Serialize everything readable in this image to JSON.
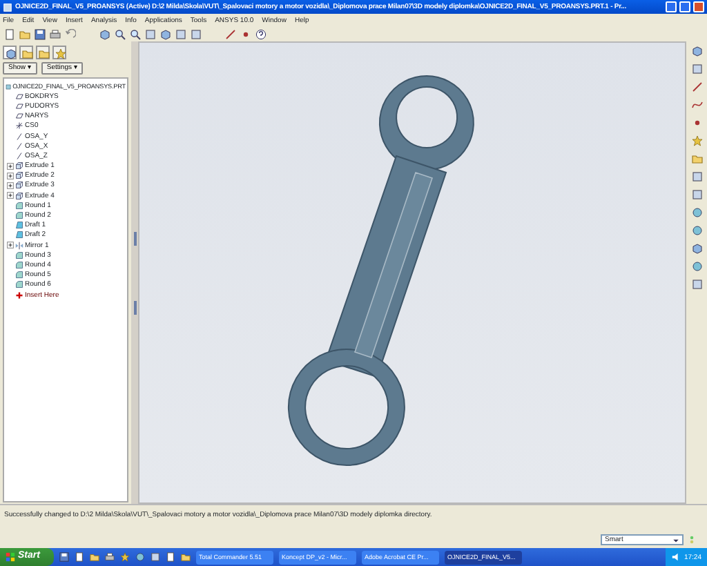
{
  "window": {
    "title": "OJNICE2D_FINAL_V5_PROANSYS (Active) D:\\2 Milda\\Skola\\VUT\\_Spalovaci motory a motor vozidla\\_Diplomova prace Milan07\\3D modely diplomka\\OJNICE2D_FINAL_V5_PROANSYS.PRT.1 - Pr..."
  },
  "menu": [
    "File",
    "Edit",
    "View",
    "Insert",
    "Analysis",
    "Info",
    "Applications",
    "Tools",
    "ANSYS 10.0",
    "Window",
    "Help"
  ],
  "panel": {
    "tabs": [
      {
        "selected": true
      },
      {
        "selected": false
      },
      {
        "selected": false
      },
      {
        "selected": false
      }
    ],
    "buttons": [
      "Show ▾",
      "Settings ▾"
    ],
    "tree": {
      "label": "OJNICE2D_FINAL_V5_PROANSYS.PRT",
      "children": [
        {
          "label": "BOKDRYS",
          "kind": "plane",
          "expander": false
        },
        {
          "label": "PUDORYS",
          "kind": "plane",
          "expander": false
        },
        {
          "label": "NARYS",
          "kind": "plane",
          "expander": false
        },
        {
          "label": "CS0",
          "kind": "csys",
          "expander": false
        },
        {
          "label": "OSA_Y",
          "kind": "axis",
          "expander": false
        },
        {
          "label": "OSA_X",
          "kind": "axis",
          "expander": false
        },
        {
          "label": "OSA_Z",
          "kind": "axis",
          "expander": false
        },
        {
          "label": "Extrude 1",
          "kind": "extrude",
          "expander": true
        },
        {
          "label": "Extrude 2",
          "kind": "extrude",
          "expander": true
        },
        {
          "label": "Extrude 3",
          "kind": "extrude",
          "expander": true
        },
        {
          "label": "Extrude 4",
          "kind": "extrude",
          "expander": true
        },
        {
          "label": "Round 1",
          "kind": "round",
          "expander": false
        },
        {
          "label": "Round 2",
          "kind": "round",
          "expander": false
        },
        {
          "label": "Draft 1",
          "kind": "draft",
          "expander": false
        },
        {
          "label": "Draft 2",
          "kind": "draft",
          "expander": false
        },
        {
          "label": "Mirror 1",
          "kind": "mirror",
          "expander": true
        },
        {
          "label": "Round 3",
          "kind": "round",
          "expander": false
        },
        {
          "label": "Round 4",
          "kind": "round",
          "expander": false
        },
        {
          "label": "Round 5",
          "kind": "round",
          "expander": false
        },
        {
          "label": "Round 6",
          "kind": "round",
          "expander": false
        },
        {
          "label": "Insert Here",
          "kind": "insert",
          "expander": false
        }
      ]
    }
  },
  "message": "Successfully changed to D:\\2 Milda\\Skola\\VUT\\_Spalovaci motory a motor vozidla\\_Diplomova prace Milan07\\3D modely diplomka directory.",
  "filter": {
    "value": "Smart"
  },
  "taskbar": {
    "start": "Start",
    "tasks": [
      {
        "label": "Total Commander 5.51",
        "selected": false
      },
      {
        "label": "Koncept DP_v2 - Micr...",
        "selected": false
      },
      {
        "label": "Adobe Acrobat CE Pr...",
        "selected": false
      },
      {
        "label": "OJNICE2D_FINAL_V5...",
        "selected": true
      }
    ],
    "clock": "17:24"
  }
}
